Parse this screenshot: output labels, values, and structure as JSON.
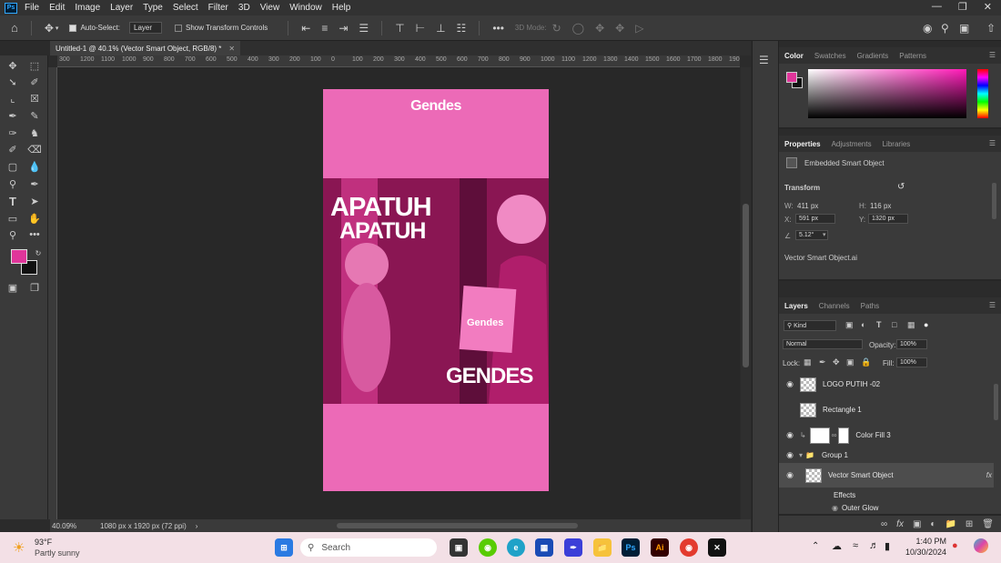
{
  "menubar": {
    "app_icon": "Ps",
    "items": [
      "File",
      "Edit",
      "Image",
      "Layer",
      "Type",
      "Select",
      "Filter",
      "3D",
      "View",
      "Window",
      "Help"
    ],
    "window_controls": [
      "minimize-icon",
      "restore-icon",
      "close-icon"
    ]
  },
  "options_bar": {
    "auto_select_label": "Auto-Select:",
    "auto_select_checked": true,
    "auto_select_target": "Layer",
    "show_transform_label": "Show Transform Controls",
    "show_transform_checked": false,
    "mode_3d_label": "3D Mode:"
  },
  "document": {
    "tab_title": "Untitled-1 @ 40.1% (Vector Smart Object, RGB/8) *",
    "logo_text": "Gendes",
    "headline_line1": "APATUH",
    "headline_line2": "APATUH",
    "brand_text": "GENDES",
    "bag_logo": "Gendes",
    "background_color": "#ec6ab7"
  },
  "ruler_h_ticks": [
    "300",
    "1200",
    "1100",
    "1000",
    "900",
    "800",
    "700",
    "600",
    "500",
    "400",
    "300",
    "200",
    "100",
    "0",
    "100",
    "200",
    "300",
    "400",
    "500",
    "600",
    "700",
    "800",
    "900",
    "1000",
    "1100",
    "1200",
    "1300",
    "1400",
    "1500",
    "1600",
    "1700",
    "1800",
    "1900"
  ],
  "status": {
    "zoom": "40.09%",
    "doc_info": "1080 px x 1920 px (72 ppi)"
  },
  "color_panel": {
    "tabs": [
      "Color",
      "Swatches",
      "Gradients",
      "Patterns"
    ],
    "active_tab": "Color",
    "foreground": "#e0359a",
    "background": "#111111"
  },
  "properties_panel": {
    "tabs": [
      "Properties",
      "Adjustments",
      "Libraries"
    ],
    "active_tab": "Properties",
    "object_type": "Embedded Smart Object",
    "transform_label": "Transform",
    "w_label": "W:",
    "w_value": "411 px",
    "h_label": "H:",
    "h_value": "116 px",
    "x_label": "X:",
    "x_value": "591 px",
    "y_label": "Y:",
    "y_value": "1320 px",
    "angle_value": "5.12°",
    "file_name": "Vector Smart Object.ai"
  },
  "layers_panel": {
    "tabs": [
      "Layers",
      "Channels",
      "Paths"
    ],
    "active_tab": "Layers",
    "filter_kind": "Kind",
    "blend_mode": "Normal",
    "opacity_label": "Opacity:",
    "opacity_value": "100%",
    "lock_label": "Lock:",
    "fill_label": "Fill:",
    "fill_value": "100%",
    "layers": [
      {
        "name": "LOGO PUTIH -02",
        "visible": true
      },
      {
        "name": "Rectangle 1",
        "visible": false
      },
      {
        "name": "Color Fill 3",
        "visible": true
      },
      {
        "name": "Group 1",
        "visible": true
      },
      {
        "name": "Vector Smart Object",
        "visible": true,
        "selected": true
      }
    ],
    "effects_label": "Effects",
    "effect_name": "Outer Glow",
    "fx_label": "fx"
  },
  "taskbar": {
    "weather_temp": "93°F",
    "weather_desc": "Partly sunny",
    "search_placeholder": "Search",
    "time": "1:40 PM",
    "date": "10/30/2024"
  }
}
